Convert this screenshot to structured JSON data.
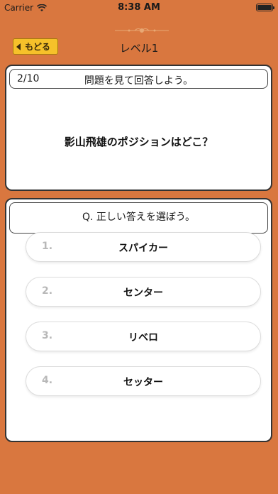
{
  "status_bar": {
    "carrier": "Carrier",
    "time": "8:38 AM",
    "battery_level": 1.0
  },
  "nav": {
    "back_label": "もどる",
    "title": "レベル1"
  },
  "question": {
    "progress": "2/10",
    "instruction": "問題を見て回答しよう。",
    "text": "影山飛雄のポジションはどこ？"
  },
  "answers": {
    "prompt": "Q. 正しい答えを選ぼう。",
    "options": [
      {
        "number": "1.",
        "label": "スパイカー"
      },
      {
        "number": "2.",
        "label": "センター"
      },
      {
        "number": "3.",
        "label": "リベロ"
      },
      {
        "number": "4.",
        "label": "セッター"
      }
    ]
  },
  "colors": {
    "background": "#d9773f",
    "back_button": "#f6c12a",
    "panel": "#ffffff"
  },
  "icons": {
    "wifi": "wifi-icon",
    "battery": "battery-icon",
    "back_arrow": "left-arrow-icon",
    "ornament": "decorative-ornament-icon"
  }
}
